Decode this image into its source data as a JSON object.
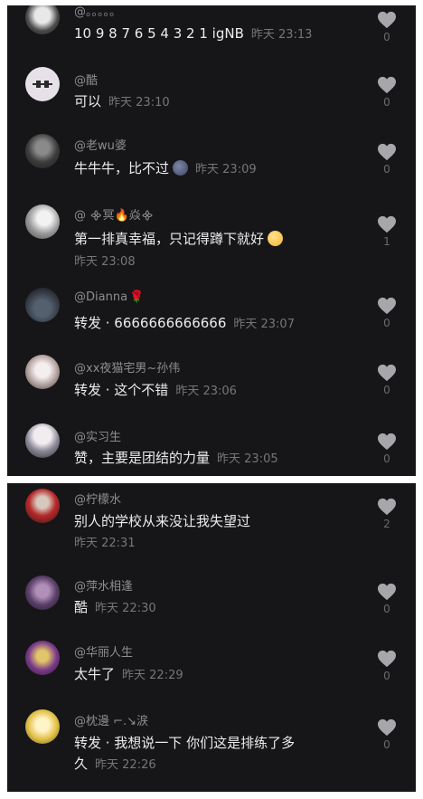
{
  "comments_top": [
    {
      "user": "@。。。。。",
      "text": "10 9 8 7 6 5 4 3 2 1 igNB",
      "time": "昨天 23:13",
      "likes": "0"
    },
    {
      "user": "@酷",
      "text": "可以",
      "time": "昨天 23:10",
      "likes": "0"
    },
    {
      "user": "@老wu婆",
      "text": "牛牛牛，比不过",
      "time": "昨天 23:09",
      "likes": "0"
    },
    {
      "user": "@ ᯽冥",
      "user_tail": "焱᯽",
      "text": "第一排真幸福，只记得蹲下就好",
      "time": "昨天 23:08",
      "likes": "1"
    },
    {
      "user": "@Dianna",
      "text": "转发 · 6666666666666",
      "time": "昨天 23:07",
      "likes": "0"
    },
    {
      "user": "@xx夜猫宅男~孙伟",
      "text": "转发 · 这个不错",
      "time": "昨天 23:06",
      "likes": "0"
    },
    {
      "user": "@实习生",
      "text": "赞，主要是团结的力量",
      "time": "昨天 23:05",
      "likes": "0"
    }
  ],
  "comments_bottom": [
    {
      "user": "@柠檬水",
      "text": "别人的学校从来没让我失望过",
      "time": "昨天 22:31",
      "likes": "2"
    },
    {
      "user": "@萍水相逢",
      "text": "酷",
      "time": "昨天 22:30",
      "likes": "0"
    },
    {
      "user": "@华丽人生",
      "text": "太牛了",
      "time": "昨天 22:29",
      "likes": "0"
    },
    {
      "user": "@枕邊 ⌐.↘涙",
      "text_line1": "转发 · 我想说一下 你们这是排练了多",
      "text_line2": "久",
      "time": "昨天 22:26",
      "likes": "0"
    }
  ],
  "colors": {
    "background": "#161618",
    "text": "#ececee",
    "meta": "#8d8d92",
    "heart": "#a7a7ab"
  }
}
